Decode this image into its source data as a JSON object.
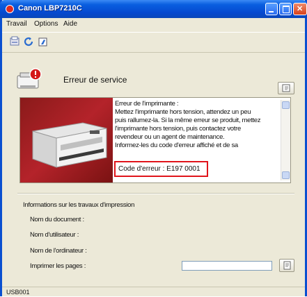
{
  "window": {
    "title": "Canon LBP7210C"
  },
  "menu": [
    "Travail",
    "Options",
    "Aide"
  ],
  "status": {
    "title": "Erreur de service"
  },
  "message": {
    "lines": [
      "Erreur de l'imprimante :",
      "Mettez l'imprimante hors tension, attendez un peu",
      "puis rallumez-la. Si la même erreur se produit, mettez",
      "l'imprimante hors tension, puis contactez votre",
      "revendeur ou un agent de maintenance.",
      "Informez-les du code d'erreur affiché et de sa"
    ],
    "error_code": "Code d'erreur : E197 0001"
  },
  "jobs": {
    "heading": "Informations sur les travaux d'impression",
    "document_label": "Nom du document :",
    "user_label": "Nom d'utilisateur :",
    "computer_label": "Nom de l'ordinateur :",
    "pages_label": "Imprimer les pages :",
    "pages_value": ""
  },
  "statusbar": {
    "port": "USB001"
  },
  "colors": {
    "titlebar": "#0549d0",
    "highlight": "#e0131a",
    "printer_bg": "#b4232a"
  },
  "icons": [
    "printer-error-icon",
    "printer-icon",
    "refresh-icon",
    "cleaning-icon",
    "manual-icon"
  ]
}
